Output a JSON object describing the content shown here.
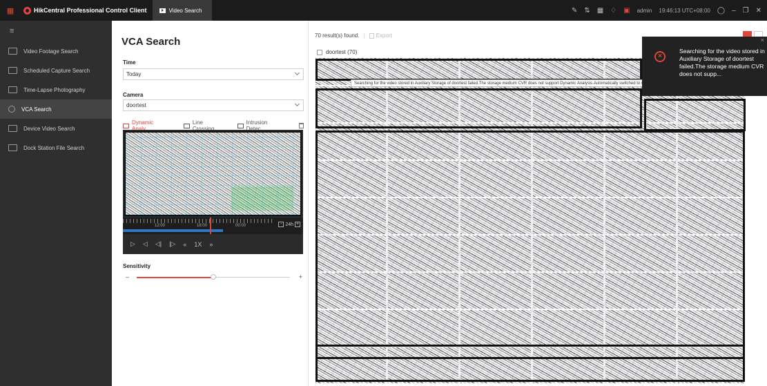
{
  "topbar": {
    "app_name": "HikCentral Professional Control Client",
    "tab_label": "Video Search",
    "user": "admin",
    "clock": "19:46:13 UTC+08:00"
  },
  "sidebar": {
    "items": [
      {
        "label": "Video Footage Search",
        "icon": "video-icon"
      },
      {
        "label": "Scheduled Capture Search",
        "icon": "image-icon"
      },
      {
        "label": "Time-Lapse Photography",
        "icon": "camera-icon"
      },
      {
        "label": "VCA Search",
        "icon": "search-icon",
        "active": true
      },
      {
        "label": "Device Video Search",
        "icon": "device-icon"
      },
      {
        "label": "Dock Station File Search",
        "icon": "dock-icon"
      }
    ]
  },
  "panel": {
    "title": "VCA Search",
    "time_label": "Time",
    "time_value": "Today",
    "camera_label": "Camera",
    "camera_value": "doortest",
    "rules": [
      "Dynamic Analy...",
      "Line Crossing",
      "Intrusion Detec..."
    ],
    "timeline": {
      "labels": [
        "12:00",
        "18:00",
        "00:00"
      ],
      "zoom": "24h"
    },
    "playback": {
      "speed": "1X"
    },
    "sensitivity_label": "Sensitivity",
    "sensitivity_level": 0.5
  },
  "results": {
    "count_text": "70 result(s) found.",
    "separator": "|",
    "export_label": "Export",
    "camera_label": "doortest (70)"
  },
  "tooltip": "Searching for the video stored in Auxiliary Storage of doortest failed.The storage medium CVR does not support Dynamic Analysis.Automatically switched to other storage medium.",
  "toast": {
    "message": "Searching for the video stored in Auxiliary Storage of doortest failed.The storage medium CVR does not supp..."
  },
  "colors": {
    "accent": "#e0463b",
    "sidebar_bg": "#2f2f2f",
    "topbar_bg": "#1b1b1b"
  }
}
